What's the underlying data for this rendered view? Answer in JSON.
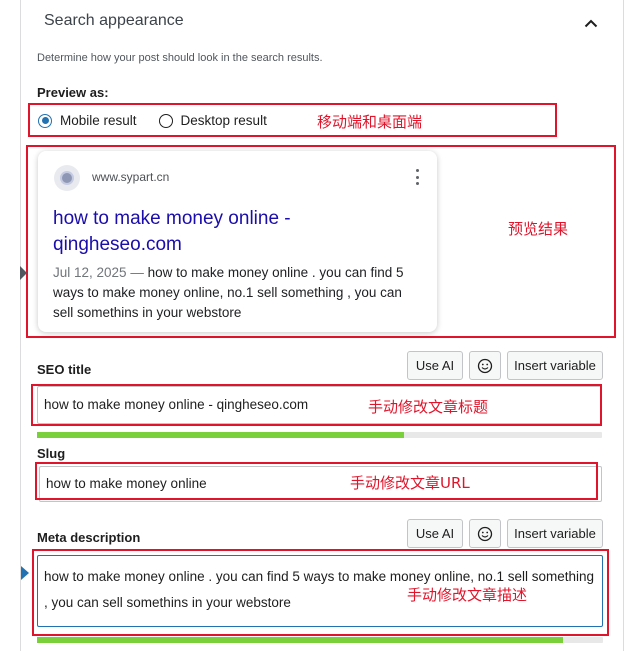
{
  "header": {
    "title": "Search appearance",
    "collapse_icon": "chevron-up-icon"
  },
  "description": "Determine how your post should look in the search results.",
  "preview": {
    "label": "Preview as:",
    "options": [
      {
        "label": "Mobile result",
        "selected": true
      },
      {
        "label": "Desktop result",
        "selected": false
      }
    ]
  },
  "result": {
    "site": "www.sypart.cn",
    "title": "how to make money online - qingheseo.com",
    "date": "Jul 12, 2025",
    "separator": "—",
    "snippet": "how to make money online . you can find 5 ways to make money online, no.1 sell something , you can sell somethins in your webstore"
  },
  "seo_title": {
    "label": "SEO title",
    "value": "how to make money online - qingheseo.com",
    "progress": 0.65,
    "progress_color": "#7ad03a"
  },
  "slug": {
    "label": "Slug",
    "value": "how to make money online"
  },
  "meta": {
    "label": "Meta description",
    "value": "how to make money online . you can find 5 ways to make money online, no.1 sell something , you can sell somethins in your webstore",
    "progress": 0.93
  },
  "buttons": {
    "use_ai": "Use AI",
    "insert_variable": "Insert variable",
    "emoji_icon": "smiley-icon"
  },
  "annotations": {
    "preview_toggle": "移动端和桌面端",
    "preview_result": "预览结果",
    "edit_title": "手动修改文章标题",
    "edit_url": "手动修改文章URL",
    "edit_desc": "手动修改文章描述"
  },
  "colors": {
    "annotation": "#e0142a",
    "link": "#1a0dab",
    "accent": "#2271b1"
  }
}
